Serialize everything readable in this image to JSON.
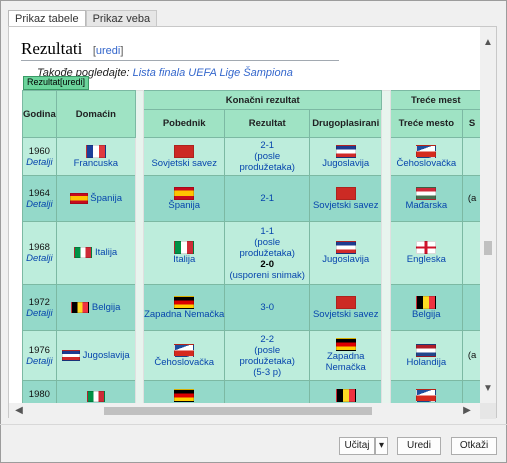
{
  "tabs": [
    "Prikaz tabele",
    "Prikaz veba"
  ],
  "section": {
    "title": "Rezultati",
    "edit_open": "[",
    "edit_label": "uredi",
    "edit_close": "]"
  },
  "hatnote": {
    "prefix": "Takođe pogledajte:",
    "link": "Lista finala UEFA Lige Šampiona"
  },
  "caption": {
    "label": "Rezultat",
    "edit": "[uredi]"
  },
  "table": {
    "headers": {
      "godina": "Godina",
      "domacin": "Domaćin",
      "konacni": "Konačni rezultat",
      "trece_group": "Treće mest",
      "pobednik": "Pobednik",
      "rezultat": "Rezultat",
      "drugoplasirani": "Drugoplasirani",
      "trece_mesto": "Treće mesto",
      "extra": "S"
    },
    "rows": [
      {
        "year": "1960",
        "detail": "Detalji",
        "host": "Francuska",
        "host_flag": "f-fr",
        "winner": "Sovjetski savez",
        "winner_flag": "f-su",
        "result1": "2-1",
        "result2": "(posle produžetaka)",
        "result3": "",
        "result4": "",
        "runner": "Jugoslavija",
        "runner_flag": "f-yu",
        "third": "Čehoslovačka",
        "third_flag": "f-cs",
        "extra": ""
      },
      {
        "year": "1964",
        "detail": "Detalji",
        "host": "Španija",
        "host_flag": "f-es",
        "winner": "Španija",
        "winner_flag": "f-es",
        "result1": "2-1",
        "result2": "",
        "result3": "",
        "result4": "",
        "runner": "Sovjetski savez",
        "runner_flag": "f-su",
        "third": "Mađarska",
        "third_flag": "f-hu",
        "extra": "(a"
      },
      {
        "year": "1968",
        "detail": "Detalji",
        "host": "Italija",
        "host_flag": "f-it",
        "winner": "Italija",
        "winner_flag": "f-it",
        "result1": "1-1",
        "result2": "(posle produžetaka)",
        "result3": "2-0",
        "result4": "(usporeni snimak)",
        "runner": "Jugoslavija",
        "runner_flag": "f-yu",
        "third": "Engleska",
        "third_flag": "f-en",
        "extra": ""
      },
      {
        "year": "1972",
        "detail": "Detalji",
        "host": "Belgija",
        "host_flag": "f-be",
        "winner": "Zapadna Nemačka",
        "winner_flag": "f-de",
        "result1": "3-0",
        "result2": "",
        "result3": "",
        "result4": "",
        "runner": "Sovjetski savez",
        "runner_flag": "f-su",
        "third": "Belgija",
        "third_flag": "f-be",
        "extra": ""
      },
      {
        "year": "1976",
        "detail": "Detalji",
        "host": "Jugoslavija",
        "host_flag": "f-yu",
        "winner": "Čehoslovačka",
        "winner_flag": "f-cs",
        "result1": "2-2",
        "result2": "(posle produžetaka)",
        "result3": "(5-3 p)",
        "result4": "",
        "runner": "Zapadna Nemačka",
        "runner_flag": "f-de",
        "third": "Holandija",
        "third_flag": "f-nl",
        "extra": "(a"
      },
      {
        "year": "1980",
        "detail": "",
        "host": "",
        "host_flag": "f-it",
        "winner": "",
        "winner_flag": "f-de",
        "result1": "",
        "result2": "",
        "result3": "",
        "result4": "",
        "runner": "",
        "runner_flag": "f-be",
        "third": "",
        "third_flag": "f-cs",
        "extra": ""
      }
    ]
  },
  "buttons": {
    "load": "Učitaj",
    "edit": "Uredi",
    "cancel": "Otkaži"
  }
}
